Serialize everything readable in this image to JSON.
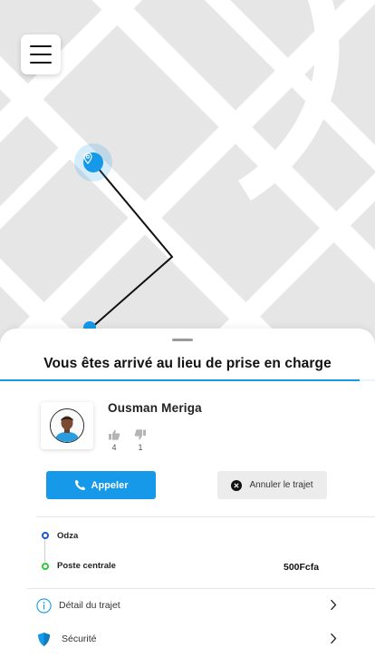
{
  "screen": {
    "title": "Vous êtes arrivé au lieu de prise en charge",
    "progress_fraction": 0.96
  },
  "map": {
    "menu_icon": "hamburger-menu-icon",
    "pickup_icon": "location-pin-icon",
    "accent_color": "#1599e8"
  },
  "driver": {
    "name": "Ousman Meriga",
    "likes": "4",
    "dislikes": "1"
  },
  "actions": {
    "call_label": "Appeler",
    "cancel_label": "Annuler le trajet"
  },
  "trip": {
    "start_label": "Odza",
    "end_label": "Poste centrale",
    "price": "500Fcfa",
    "start_color": "#1c58c9",
    "end_color": "#2ecc3a"
  },
  "menu_rows": [
    {
      "label": "Détail du trajet",
      "icon": "info-icon"
    },
    {
      "label": "Sécurité",
      "icon": "shield-icon"
    }
  ]
}
